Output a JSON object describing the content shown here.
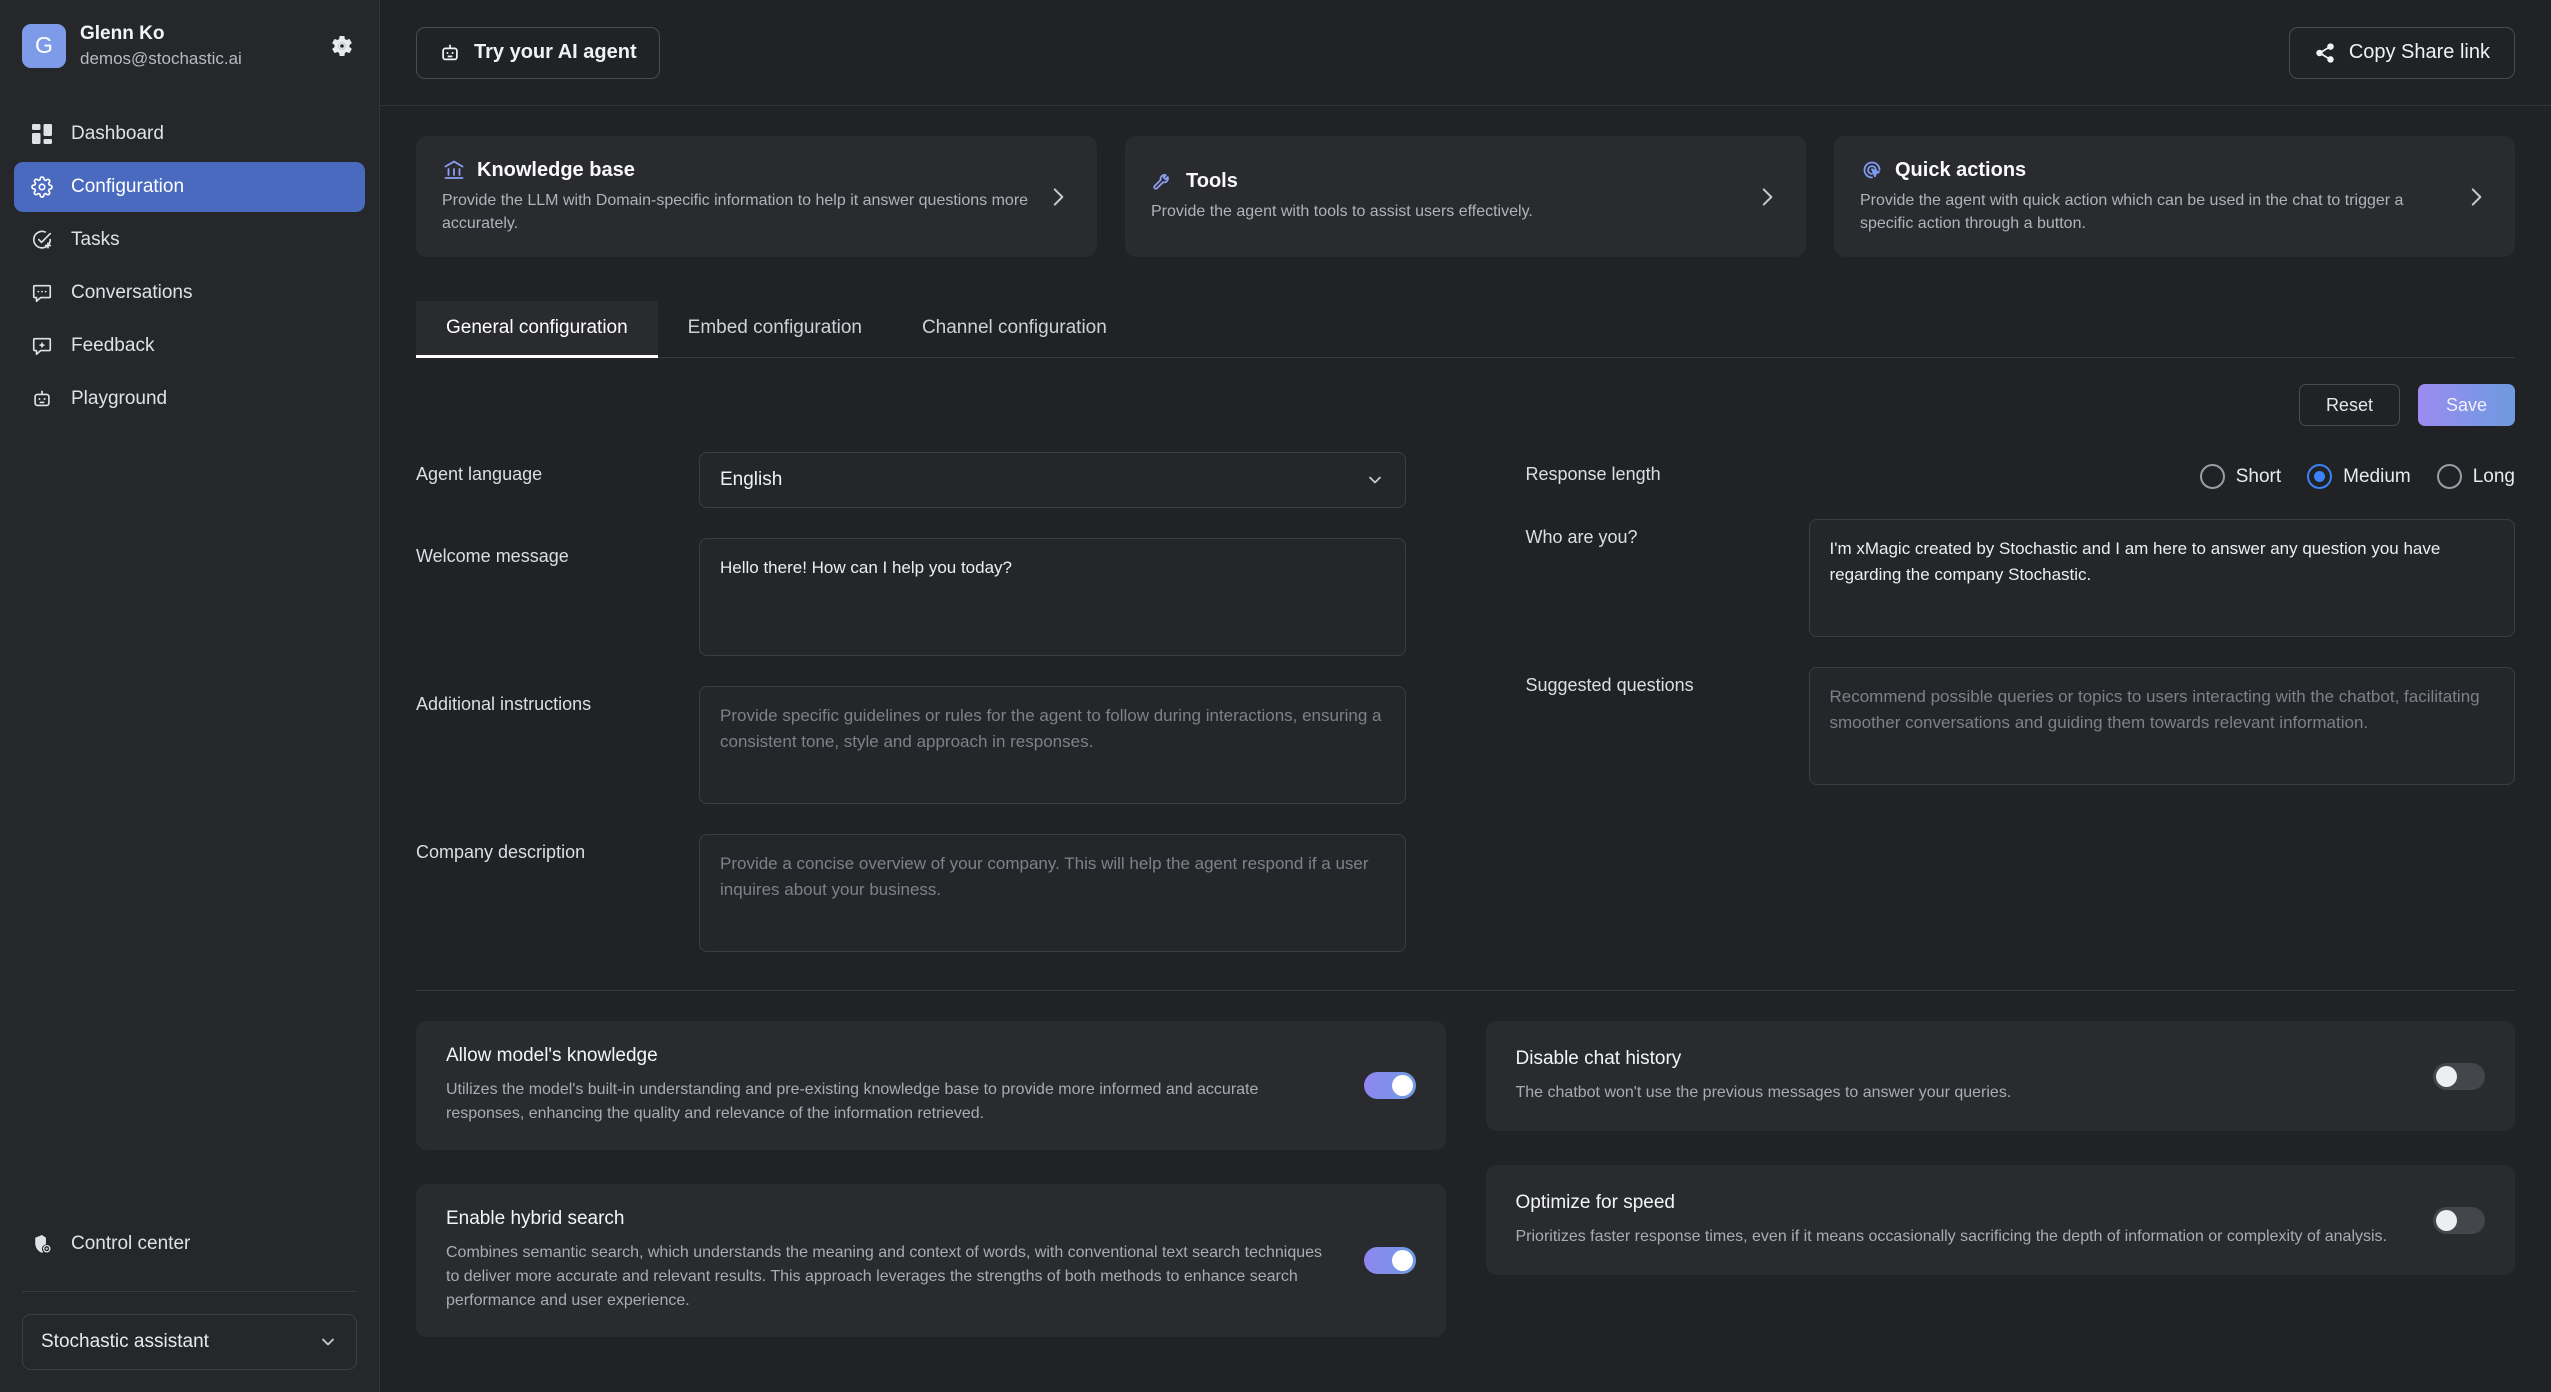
{
  "sidebar": {
    "profile": {
      "avatar_initial": "G",
      "name": "Glenn Ko",
      "email": "demos@stochastic.ai",
      "settings_icon": "gear-icon"
    },
    "items": [
      {
        "label": "Dashboard",
        "icon": "dashboard-grid-icon",
        "active": false
      },
      {
        "label": "Configuration",
        "icon": "gear-icon",
        "active": true
      },
      {
        "label": "Tasks",
        "icon": "check-circle-plus-icon",
        "active": false
      },
      {
        "label": "Conversations",
        "icon": "chat-bubble-icon",
        "active": false
      },
      {
        "label": "Feedback",
        "icon": "chat-plus-icon",
        "active": false
      },
      {
        "label": "Playground",
        "icon": "robot-icon",
        "active": false
      }
    ],
    "control_center": {
      "label": "Control center",
      "icon": "shield-icon"
    },
    "assistant_select": {
      "value": "Stochastic assistant",
      "icon": "chevron-down-icon"
    }
  },
  "topbar": {
    "try_agent": {
      "label": "Try your AI agent",
      "icon": "robot-icon"
    },
    "copy_share": {
      "label": "Copy Share link",
      "icon": "share-icon"
    }
  },
  "cards": [
    {
      "title": "Knowledge base",
      "description": "Provide the LLM with Domain-specific information to help it answer questions more accurately.",
      "icon": "bank-columns-icon",
      "icon_color": "#8c9ef0",
      "chevron": "chevron-right-icon"
    },
    {
      "title": "Tools",
      "description": "Provide the agent with tools to assist users effectively.",
      "icon": "wrench-icon",
      "icon_color": "#8c9ef0",
      "chevron": "chevron-right-icon"
    },
    {
      "title": "Quick actions",
      "description": "Provide the agent with quick action which can be used in the chat to trigger a specific action through a button.",
      "icon": "cursor-target-icon",
      "icon_color": "#7b9bf2",
      "chevron": "chevron-right-icon"
    }
  ],
  "tabs": [
    {
      "label": "General configuration",
      "active": true
    },
    {
      "label": "Embed configuration",
      "active": false
    },
    {
      "label": "Channel configuration",
      "active": false
    }
  ],
  "actions": {
    "reset_label": "Reset",
    "save_label": "Save",
    "save_gradient_from": "#9b8cf0",
    "save_gradient_to": "#6d9ae0"
  },
  "form": {
    "agent_language": {
      "label": "Agent language",
      "value": "English",
      "icon": "chevron-down-icon"
    },
    "response_length": {
      "label": "Response length",
      "options": [
        {
          "label": "Short",
          "selected": false
        },
        {
          "label": "Medium",
          "selected": true
        },
        {
          "label": "Long",
          "selected": false
        }
      ],
      "selected_color": "#3b82f6"
    },
    "welcome_message": {
      "label": "Welcome message",
      "value": "Hello there! How can I help you today?",
      "placeholder": ""
    },
    "who_are_you": {
      "label": "Who are you?",
      "value": "I'm xMagic created by Stochastic and I am here to answer any question you have regarding the company Stochastic.",
      "placeholder": ""
    },
    "additional_instructions": {
      "label": "Additional instructions",
      "value": "",
      "placeholder": "Provide specific guidelines or rules for the agent to follow during interactions, ensuring a consistent tone, style and approach in responses."
    },
    "suggested_questions": {
      "label": "Suggested questions",
      "value": "",
      "placeholder": "Recommend possible queries or topics to users interacting with the chatbot, facilitating smoother conversations and guiding them towards relevant information."
    },
    "company_description": {
      "label": "Company description",
      "value": "",
      "placeholder": "Provide a concise overview of your company. This will help the agent respond if a user inquires about your business."
    }
  },
  "toggles": {
    "left": [
      {
        "title": "Allow model's knowledge",
        "description": "Utilizes the model's built-in understanding and pre-existing knowledge base to provide more informed and accurate responses, enhancing the quality and relevance of the information retrieved.",
        "on": true
      },
      {
        "title": "Enable hybrid search",
        "description": "Combines semantic search, which understands the meaning and context of words, with conventional text search techniques to deliver more accurate and relevant results. This approach leverages the strengths of both methods to enhance search performance and user experience.",
        "on": true
      }
    ],
    "right": [
      {
        "title": "Disable chat history",
        "description": "The chatbot won't use the previous messages to answer your queries.",
        "on": false
      },
      {
        "title": "Optimize for speed",
        "description": "Prioritizes faster response times, even if it means occasionally sacrificing the depth of information or complexity of analysis.",
        "on": false
      }
    ]
  },
  "theme": {
    "background": "#212226",
    "panel": "#2a2b2f",
    "sidebar": "#26272b",
    "accent": "#4a6ac0",
    "border": "#3a3b40"
  }
}
